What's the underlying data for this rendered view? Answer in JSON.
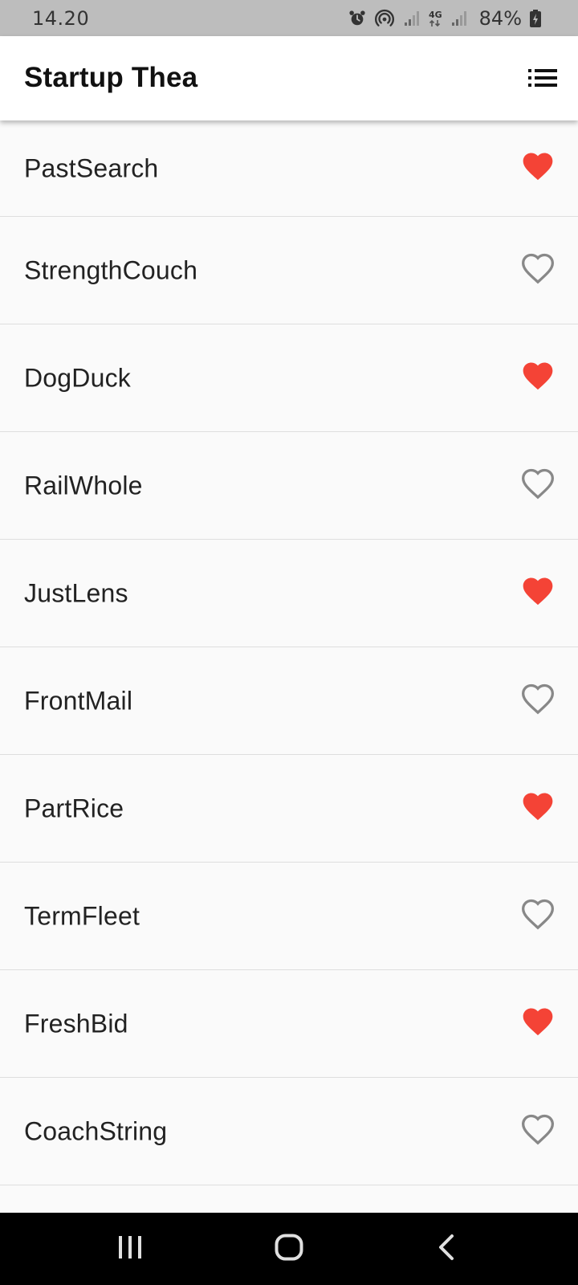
{
  "status_bar": {
    "time": "14.20",
    "battery": "84%",
    "network": "4G",
    "icons": [
      "alarm-icon",
      "hotspot-icon",
      "signal-icon",
      "network-4g-icon",
      "signal-icon",
      "battery-charging-icon"
    ]
  },
  "app_bar": {
    "title": "Startup Thea",
    "action_icon": "list-icon"
  },
  "colors": {
    "favorite": "#f44336",
    "not_favorite": "#888888",
    "app_bar_bg": "#ffffff",
    "list_bg": "#fafafa",
    "status_bar_bg": "#bdbdbd",
    "nav_bar_bg": "#000000"
  },
  "list": {
    "items": [
      {
        "label": "PastSearch",
        "favorite": true
      },
      {
        "label": "StrengthCouch",
        "favorite": false
      },
      {
        "label": "DogDuck",
        "favorite": true
      },
      {
        "label": "RailWhole",
        "favorite": false
      },
      {
        "label": "JustLens",
        "favorite": true
      },
      {
        "label": "FrontMail",
        "favorite": false
      },
      {
        "label": "PartRice",
        "favorite": true
      },
      {
        "label": "TermFleet",
        "favorite": false
      },
      {
        "label": "FreshBid",
        "favorite": true
      },
      {
        "label": "CoachString",
        "favorite": false
      }
    ]
  },
  "nav_bar": {
    "buttons": [
      "recent-apps-icon",
      "home-icon",
      "back-icon"
    ]
  }
}
